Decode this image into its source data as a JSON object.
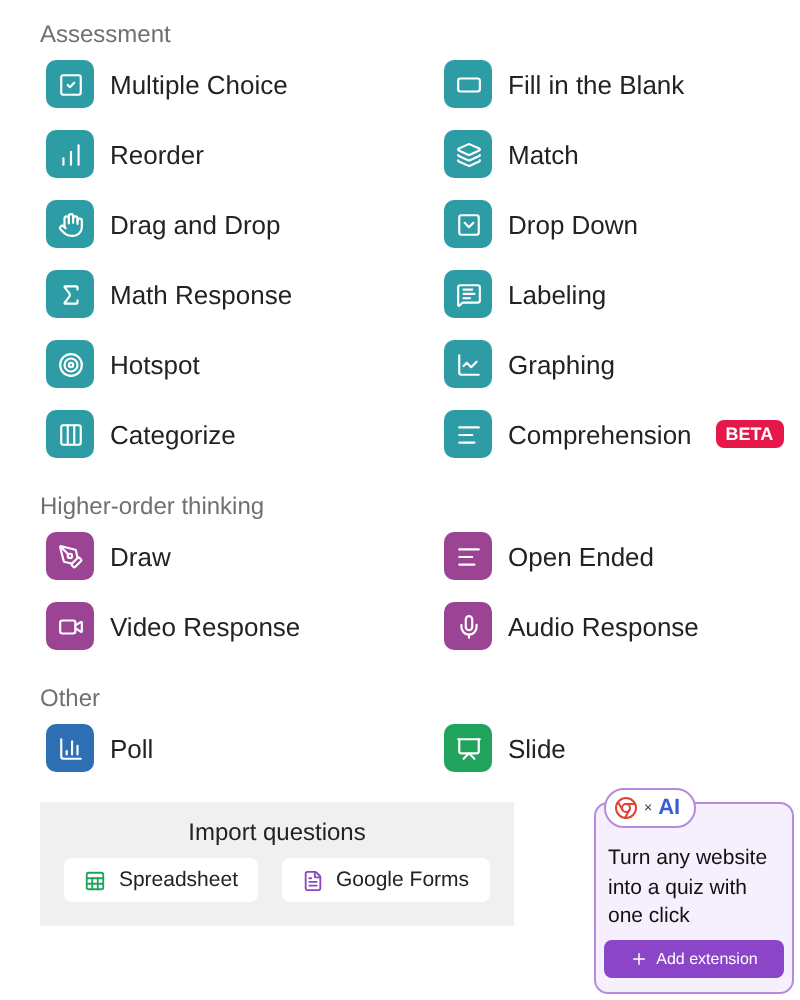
{
  "sections": [
    {
      "title": "Assessment",
      "items": [
        {
          "label": "Multiple Choice",
          "color": "#2d9ca4"
        },
        {
          "label": "Fill in the Blank",
          "color": "#2d9ca4"
        },
        {
          "label": "Reorder",
          "color": "#2d9ca4"
        },
        {
          "label": "Match",
          "color": "#2d9ca4"
        },
        {
          "label": "Drag and Drop",
          "color": "#2d9ca4"
        },
        {
          "label": "Drop Down",
          "color": "#2d9ca4"
        },
        {
          "label": "Math Response",
          "color": "#2d9ca4"
        },
        {
          "label": "Labeling",
          "color": "#2d9ca4"
        },
        {
          "label": "Hotspot",
          "color": "#2d9ca4"
        },
        {
          "label": "Graphing",
          "color": "#2d9ca4"
        },
        {
          "label": "Categorize",
          "color": "#2d9ca4"
        },
        {
          "label": "Comprehension",
          "color": "#2d9ca4",
          "badge": "BETA"
        }
      ]
    },
    {
      "title": "Higher-order thinking",
      "items": [
        {
          "label": "Draw",
          "color": "#9a4493"
        },
        {
          "label": "Open Ended",
          "color": "#9a4493"
        },
        {
          "label": "Video Response",
          "color": "#9a4493"
        },
        {
          "label": "Audio Response",
          "color": "#9a4493"
        }
      ]
    },
    {
      "title": "Other",
      "items": [
        {
          "label": "Poll",
          "color": "#2e6fb3"
        },
        {
          "label": "Slide",
          "color": "#20a35c"
        }
      ]
    }
  ],
  "import": {
    "title": "Import questions",
    "buttons": [
      "Spreadsheet",
      "Google Forms"
    ]
  },
  "promo": {
    "times": "×",
    "ai": "AI",
    "text": "Turn any website into a quiz with one click",
    "button": "Add extension"
  }
}
